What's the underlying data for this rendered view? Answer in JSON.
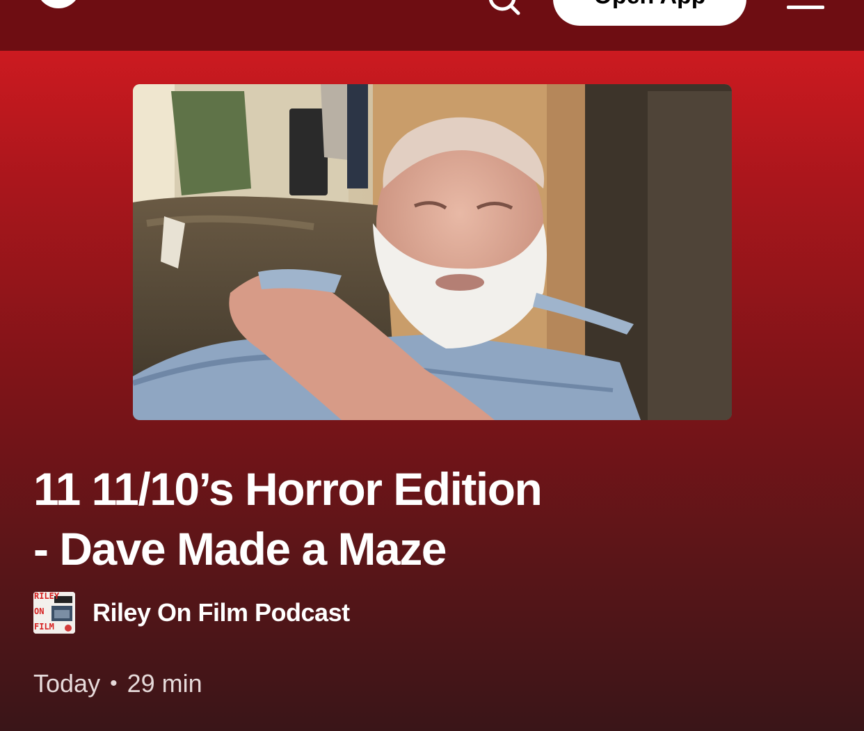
{
  "header": {
    "open_app_label": "Open App",
    "logo_icon": "spotify-logo-icon",
    "search_icon": "search-icon",
    "menu_icon": "hamburger-menu-icon"
  },
  "episode": {
    "title_line1": "11 11/10’s Horror Edition",
    "title_line2": "- Dave Made a Maze",
    "cover_image": "episode-cover-photo",
    "show_name": "Riley On Film Podcast",
    "show_art": {
      "line1": "RILEY",
      "line2": "ON",
      "line3": "FILM"
    },
    "date": "Today",
    "separator": "•",
    "duration": "29 min"
  },
  "colors": {
    "header_bg": "#6e0d12",
    "gradient_top": "#cc1a20",
    "gradient_bottom": "#3a1518",
    "text": "#ffffff"
  }
}
